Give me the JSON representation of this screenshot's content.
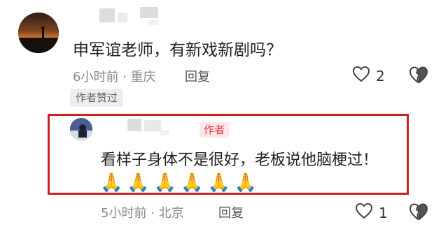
{
  "top_comment": {
    "text": "申军谊老师，有新戏新剧吗？",
    "meta": "6小时前 · 重庆",
    "reply_label": "回复",
    "like_count": "2",
    "badge": "作者赞过"
  },
  "reply_comment": {
    "author_badge": "作者",
    "text": "看样子身体不是很好，老板说他脑梗过！",
    "emojis": [
      "🙏",
      "🙏",
      "🙏",
      "🙏",
      "🙏",
      "🙏"
    ],
    "meta": "5小时前 · 北京",
    "reply_label": "回复",
    "like_count": "1"
  },
  "colors": {
    "highlight_border": "#c8241e",
    "author_badge_bg": "#fde7e8",
    "author_badge_text": "#ee3347"
  },
  "icons": {
    "like": "heart-outline-icon",
    "dislike": "broken-heart-icon"
  }
}
